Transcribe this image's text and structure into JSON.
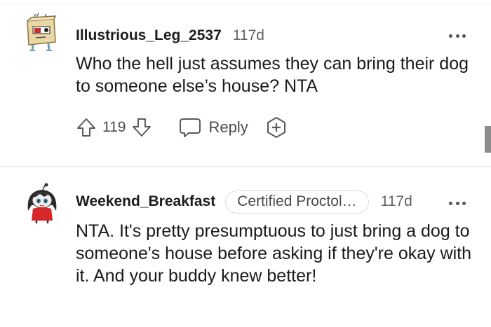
{
  "comments": [
    {
      "username": "Illustrious_Leg_2537",
      "age": "117d",
      "text": "Who the hell just assumes they can bring their dog to someone else’s house? NTA",
      "score": "119",
      "reply_label": "Reply",
      "avatar_icon": "box-robot-avatar-icon"
    },
    {
      "username": "Weekend_Breakfast",
      "flair": "Certified Proctol…",
      "age": "117d",
      "text": "NTA. It's pretty presumptuous to just bring a dog to someone's house before asking if they're okay with it. And your buddy knew better!",
      "avatar_icon": "snoo-girl-avatar-icon"
    }
  ],
  "colors": {
    "text": "#1a1a1b",
    "muted": "#5f6368",
    "divider": "#ededed",
    "flair_border": "#dadada"
  }
}
